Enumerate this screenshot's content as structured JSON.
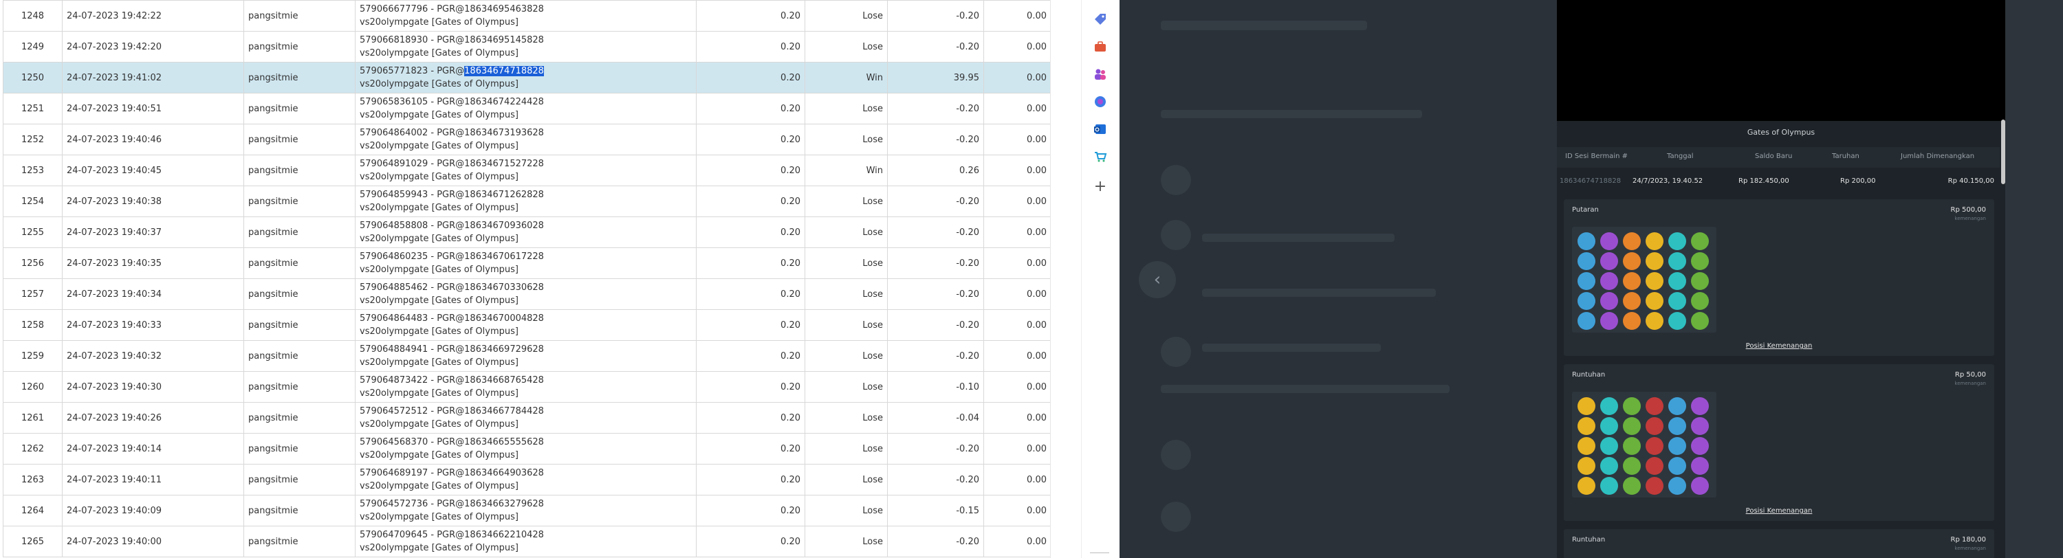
{
  "table": {
    "rows": [
      {
        "no": "1248",
        "date": "24-07-2023 19:42:22",
        "user": "pangsitmie",
        "id1": "579066677796 - PGR@18634695463828",
        "id2": "vs20olympgate [Gates of Olympus]",
        "bet": "0.20",
        "status": "Lose",
        "win": "-0.20",
        "jp": "0.00"
      },
      {
        "no": "1249",
        "date": "24-07-2023 19:42:20",
        "user": "pangsitmie",
        "id1": "579066818930 - PGR@18634695145828",
        "id2": "vs20olympgate [Gates of Olympus]",
        "bet": "0.20",
        "status": "Lose",
        "win": "-0.20",
        "jp": "0.00"
      },
      {
        "no": "1250",
        "date": "24-07-2023 19:41:02",
        "user": "pangsitmie",
        "id1": "579065771823 - PGR@",
        "id1hl": "18634674718828",
        "id2": "vs20olympgate [Gates of Olympus]",
        "bet": "0.20",
        "status": "Win",
        "win": "39.95",
        "jp": "0.00",
        "selected": true
      },
      {
        "no": "1251",
        "date": "24-07-2023 19:40:51",
        "user": "pangsitmie",
        "id1": "579065836105 - PGR@18634674224428",
        "id2": "vs20olympgate [Gates of Olympus]",
        "bet": "0.20",
        "status": "Lose",
        "win": "-0.20",
        "jp": "0.00"
      },
      {
        "no": "1252",
        "date": "24-07-2023 19:40:46",
        "user": "pangsitmie",
        "id1": "579064864002 - PGR@18634673193628",
        "id2": "vs20olympgate [Gates of Olympus]",
        "bet": "0.20",
        "status": "Lose",
        "win": "-0.20",
        "jp": "0.00"
      },
      {
        "no": "1253",
        "date": "24-07-2023 19:40:45",
        "user": "pangsitmie",
        "id1": "579064891029 - PGR@18634671527228",
        "id2": "vs20olympgate [Gates of Olympus]",
        "bet": "0.20",
        "status": "Win",
        "win": "0.26",
        "jp": "0.00"
      },
      {
        "no": "1254",
        "date": "24-07-2023 19:40:38",
        "user": "pangsitmie",
        "id1": "579064859943 - PGR@18634671262828",
        "id2": "vs20olympgate [Gates of Olympus]",
        "bet": "0.20",
        "status": "Lose",
        "win": "-0.20",
        "jp": "0.00"
      },
      {
        "no": "1255",
        "date": "24-07-2023 19:40:37",
        "user": "pangsitmie",
        "id1": "579064858808 - PGR@18634670936028",
        "id2": "vs20olympgate [Gates of Olympus]",
        "bet": "0.20",
        "status": "Lose",
        "win": "-0.20",
        "jp": "0.00"
      },
      {
        "no": "1256",
        "date": "24-07-2023 19:40:35",
        "user": "pangsitmie",
        "id1": "579064860235 - PGR@18634670617228",
        "id2": "vs20olympgate [Gates of Olympus]",
        "bet": "0.20",
        "status": "Lose",
        "win": "-0.20",
        "jp": "0.00"
      },
      {
        "no": "1257",
        "date": "24-07-2023 19:40:34",
        "user": "pangsitmie",
        "id1": "579064885462 - PGR@18634670330628",
        "id2": "vs20olympgate [Gates of Olympus]",
        "bet": "0.20",
        "status": "Lose",
        "win": "-0.20",
        "jp": "0.00"
      },
      {
        "no": "1258",
        "date": "24-07-2023 19:40:33",
        "user": "pangsitmie",
        "id1": "579064864483 - PGR@18634670004828",
        "id2": "vs20olympgate [Gates of Olympus]",
        "bet": "0.20",
        "status": "Lose",
        "win": "-0.20",
        "jp": "0.00"
      },
      {
        "no": "1259",
        "date": "24-07-2023 19:40:32",
        "user": "pangsitmie",
        "id1": "579064884941 - PGR@18634669729628",
        "id2": "vs20olympgate [Gates of Olympus]",
        "bet": "0.20",
        "status": "Lose",
        "win": "-0.20",
        "jp": "0.00"
      },
      {
        "no": "1260",
        "date": "24-07-2023 19:40:30",
        "user": "pangsitmie",
        "id1": "579064873422 - PGR@18634668765428",
        "id2": "vs20olympgate [Gates of Olympus]",
        "bet": "0.20",
        "status": "Lose",
        "win": "-0.10",
        "jp": "0.00"
      },
      {
        "no": "1261",
        "date": "24-07-2023 19:40:26",
        "user": "pangsitmie",
        "id1": "579064572512 - PGR@18634667784428",
        "id2": "vs20olympgate [Gates of Olympus]",
        "bet": "0.20",
        "status": "Lose",
        "win": "-0.04",
        "jp": "0.00"
      },
      {
        "no": "1262",
        "date": "24-07-2023 19:40:14",
        "user": "pangsitmie",
        "id1": "579064568370 - PGR@18634665555628",
        "id2": "vs20olympgate [Gates of Olympus]",
        "bet": "0.20",
        "status": "Lose",
        "win": "-0.20",
        "jp": "0.00"
      },
      {
        "no": "1263",
        "date": "24-07-2023 19:40:11",
        "user": "pangsitmie",
        "id1": "579064689197 - PGR@18634664903628",
        "id2": "vs20olympgate [Gates of Olympus]",
        "bet": "0.20",
        "status": "Lose",
        "win": "-0.20",
        "jp": "0.00"
      },
      {
        "no": "1264",
        "date": "24-07-2023 19:40:09",
        "user": "pangsitmie",
        "id1": "579064572736 - PGR@18634663279628",
        "id2": "vs20olympgate [Gates of Olympus]",
        "bet": "0.20",
        "status": "Lose",
        "win": "-0.15",
        "jp": "0.00"
      },
      {
        "no": "1265",
        "date": "24-07-2023 19:40:00",
        "user": "pangsitmie",
        "id1": "579064709645 - PGR@18634662210428",
        "id2": "vs20olympgate [Gates of Olympus]",
        "bet": "0.20",
        "status": "Lose",
        "win": "-0.20",
        "jp": "0.00"
      }
    ]
  },
  "side_icons": [
    "tag-icon",
    "briefcase-icon",
    "people-icon",
    "copilot-icon",
    "outlook-icon",
    "shopping-icon",
    "plus-icon"
  ],
  "modal": {
    "title": "Gates of Olympus",
    "headers": [
      "ID Sesi Bermain #",
      "Tanggal",
      "Saldo Baru",
      "Taruhan",
      "Jumlah Dimenangkan"
    ],
    "summary": [
      "18634674718828",
      "24/7/2023, 19.40.52",
      "Rp 182.450,00",
      "Rp 200,00",
      "Rp 40.150,00"
    ],
    "panels": [
      {
        "title": "Putaran",
        "amount": "Rp 500,00",
        "sub": "kemenangan",
        "link": "Posisi Kemenangan"
      },
      {
        "title": "Runtuhan",
        "amount": "Rp 50,00",
        "sub": "kemenangan",
        "link": "Posisi Kemenangan"
      },
      {
        "title": "Runtuhan",
        "amount": "Rp 180,00",
        "sub": "kemenangan"
      }
    ]
  },
  "colors": {
    "lose": "#e02020",
    "win": "#1c9a1c",
    "selected_row": "#cfe6ef",
    "highlight": "#1a5fd8",
    "overlay": "#2a3138",
    "modal": "#1d2328"
  }
}
